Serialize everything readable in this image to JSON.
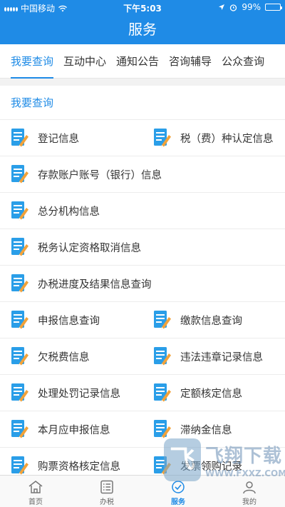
{
  "status_bar": {
    "carrier": "中国移动",
    "time": "下午5:03",
    "battery": "99%"
  },
  "header": {
    "title": "服务"
  },
  "tabs": [
    {
      "label": "我要查询",
      "active": true
    },
    {
      "label": "互动中心",
      "active": false
    },
    {
      "label": "通知公告",
      "active": false
    },
    {
      "label": "咨询辅导",
      "active": false
    },
    {
      "label": "公众查询",
      "active": false
    }
  ],
  "section": {
    "title": "我要查询"
  },
  "items": {
    "r0a": "登记信息",
    "r0b": "税（费）种认定信息",
    "r1": "存款账户账号（银行）信息",
    "r2": "总分机构信息",
    "r3": "税务认定资格取消信息",
    "r4": "办税进度及结果信息查询",
    "r5a": "申报信息查询",
    "r5b": "缴款信息查询",
    "r6a": "欠税费信息",
    "r6b": "违法违章记录信息",
    "r7a": "处理处罚记录信息",
    "r7b": "定额核定信息",
    "r8a": "本月应申报信息",
    "r8b": "滞纳金信息",
    "r9a": "购票资格核定信息",
    "r9b": "发票领购记录"
  },
  "tabbar": [
    {
      "label": "首页",
      "icon": "home-icon",
      "active": false
    },
    {
      "label": "办税",
      "icon": "list-icon",
      "active": false
    },
    {
      "label": "服务",
      "icon": "service-icon",
      "active": true
    },
    {
      "label": "我的",
      "icon": "user-icon",
      "active": false
    }
  ],
  "watermark": {
    "logo": "飞",
    "text": "飞翔下载",
    "url": "WWW.FXXZ.COM"
  },
  "colors": {
    "primary": "#1f8be6",
    "icon_blue": "#2a9ee8",
    "icon_orange": "#f2a23a"
  }
}
